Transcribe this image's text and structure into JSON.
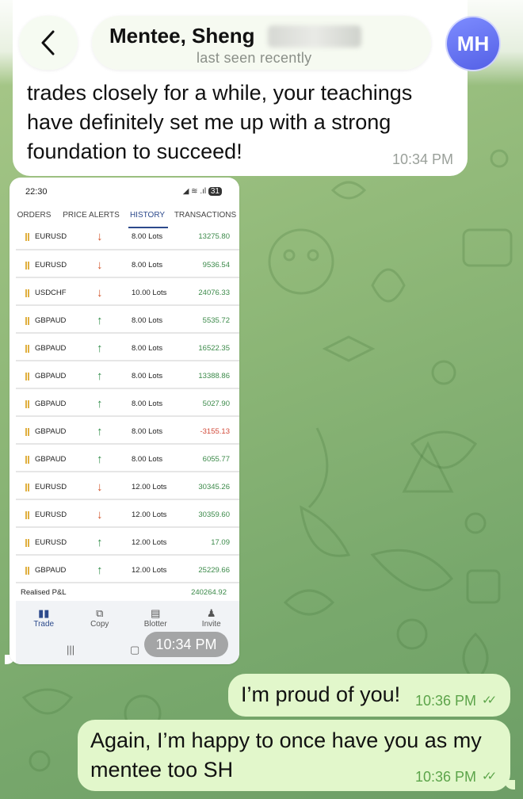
{
  "header": {
    "back_icon": "chevron-left-icon",
    "chat_name": "Mentee, Sheng",
    "status": "last seen recently",
    "avatar_initials": "MH",
    "avatar_color": "#6a75f2"
  },
  "incoming_message": {
    "text": "trades closely for a while, your teachings have definitely set me up with a strong foundation to succeed!",
    "time": "10:34 PM"
  },
  "image_message": {
    "time": "10:34 PM",
    "screenshot": {
      "status_time": "22:30",
      "battery": "31",
      "tabs": [
        "ORDERS",
        "PRICE ALERTS",
        "HISTORY",
        "TRANSACTIONS"
      ],
      "active_tab": "HISTORY",
      "rows": [
        {
          "symbol": "EURUSD",
          "dir": "down",
          "lots": "8.00 Lots",
          "pl": "13275.80",
          "sign": "pos"
        },
        {
          "symbol": "EURUSD",
          "dir": "down",
          "lots": "8.00 Lots",
          "pl": "9536.54",
          "sign": "pos"
        },
        {
          "symbol": "USDCHF",
          "dir": "down",
          "lots": "10.00 Lots",
          "pl": "24076.33",
          "sign": "pos"
        },
        {
          "symbol": "GBPAUD",
          "dir": "up",
          "lots": "8.00 Lots",
          "pl": "5535.72",
          "sign": "pos"
        },
        {
          "symbol": "GBPAUD",
          "dir": "up",
          "lots": "8.00 Lots",
          "pl": "16522.35",
          "sign": "pos"
        },
        {
          "symbol": "GBPAUD",
          "dir": "up",
          "lots": "8.00 Lots",
          "pl": "13388.86",
          "sign": "pos"
        },
        {
          "symbol": "GBPAUD",
          "dir": "up",
          "lots": "8.00 Lots",
          "pl": "5027.90",
          "sign": "pos"
        },
        {
          "symbol": "GBPAUD",
          "dir": "up",
          "lots": "8.00 Lots",
          "pl": "-3155.13",
          "sign": "neg"
        },
        {
          "symbol": "GBPAUD",
          "dir": "up",
          "lots": "8.00 Lots",
          "pl": "6055.77",
          "sign": "pos"
        },
        {
          "symbol": "EURUSD",
          "dir": "down",
          "lots": "12.00 Lots",
          "pl": "30345.26",
          "sign": "pos"
        },
        {
          "symbol": "EURUSD",
          "dir": "down",
          "lots": "12.00 Lots",
          "pl": "30359.60",
          "sign": "pos"
        },
        {
          "symbol": "EURUSD",
          "dir": "up",
          "lots": "12.00 Lots",
          "pl": "17.09",
          "sign": "pos"
        },
        {
          "symbol": "GBPAUD",
          "dir": "up",
          "lots": "12.00 Lots",
          "pl": "25229.66",
          "sign": "pos"
        }
      ],
      "realised_label": "Realised P&L",
      "realised_value": "240264.92",
      "nav": [
        {
          "label": "Trade",
          "icon": "candlestick-icon"
        },
        {
          "label": "Copy",
          "icon": "copy-icon"
        },
        {
          "label": "Blotter",
          "icon": "blotter-icon"
        },
        {
          "label": "Invite",
          "icon": "invite-icon"
        }
      ]
    }
  },
  "outgoing_messages": [
    {
      "text": "I’m proud of you!",
      "time": "10:36 PM"
    },
    {
      "text": "Again, I’m happy to once have you as my mentee too SH",
      "time": "10:36 PM"
    }
  ],
  "colors": {
    "incoming_bubble": "#ffffff",
    "outgoing_bubble": "#e2f7cb",
    "outgoing_time": "#5ca44a",
    "wallpaper": "#8fb878"
  }
}
